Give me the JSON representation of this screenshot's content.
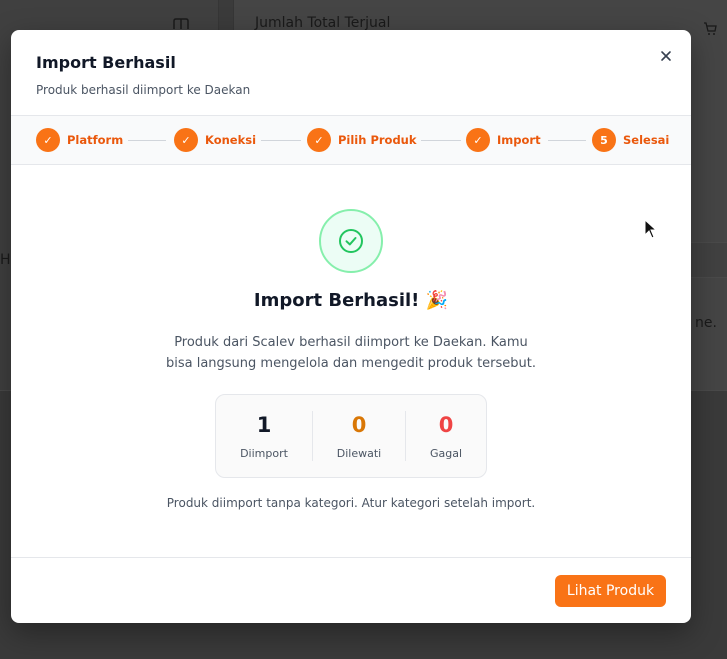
{
  "background": {
    "header_text": "Jumlah Total Terjual",
    "left_char": "H",
    "right_text": "ne."
  },
  "modal": {
    "title": "Import Berhasil",
    "subtitle": "Produk berhasil diimport ke Daekan",
    "close_icon": "close-icon"
  },
  "stepper": {
    "steps": [
      {
        "marker": "✓",
        "label": "Platform",
        "state": "done"
      },
      {
        "marker": "✓",
        "label": "Koneksi",
        "state": "done"
      },
      {
        "marker": "✓",
        "label": "Pilih Produk",
        "state": "done"
      },
      {
        "marker": "✓",
        "label": "Import",
        "state": "done"
      },
      {
        "marker": "5",
        "label": "Selesai",
        "state": "current"
      }
    ]
  },
  "result": {
    "icon": "check-circle-icon",
    "title": "Import Berhasil! 🎉",
    "description": "Produk dari Scalev berhasil diimport ke Daekan. Kamu bisa langsung mengelola dan mengedit produk tersebut.",
    "stats": [
      {
        "value": "1",
        "label": "Diimport",
        "color": "#111827"
      },
      {
        "value": "0",
        "label": "Dilewati",
        "color": "#d97706"
      },
      {
        "value": "0",
        "label": "Gagal",
        "color": "#ef4444"
      }
    ],
    "note": "Produk diimport tanpa kategori. Atur kategori setelah import."
  },
  "footer": {
    "primary_label": "Lihat Produk"
  },
  "colors": {
    "accent": "#f97316",
    "accent_text": "#ea580c",
    "success": "#22c55e"
  }
}
